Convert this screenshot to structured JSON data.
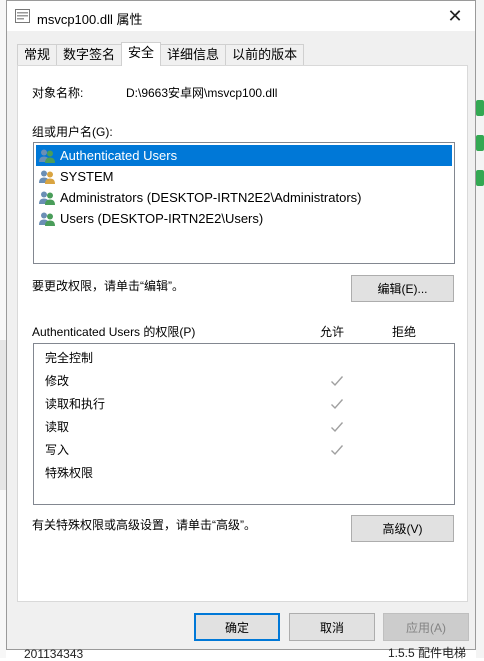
{
  "window": {
    "title": "msvcp100.dll 属性",
    "close_glyph": "✕"
  },
  "tabs": [
    {
      "label": "常规"
    },
    {
      "label": "数字签名"
    },
    {
      "label": "安全"
    },
    {
      "label": "详细信息"
    },
    {
      "label": "以前的版本"
    }
  ],
  "security": {
    "object_label": "对象名称:",
    "object_value": "D:\\9663安卓网\\msvcp100.dll",
    "group_label": "组或用户名(G):",
    "users": [
      {
        "name": "Authenticated Users",
        "icon": "users-group-icon"
      },
      {
        "name": "SYSTEM",
        "icon": "users-group-icon"
      },
      {
        "name": "Administrators (DESKTOP-IRTN2E2\\Administrators)",
        "icon": "users-group-icon"
      },
      {
        "name": "Users (DESKTOP-IRTN2E2\\Users)",
        "icon": "users-group-icon"
      }
    ],
    "selected_user_index": 0,
    "change_hint": "要更改权限，请单击“编辑”。",
    "edit_button": "编辑(E)...",
    "permissions_title": "Authenticated Users 的权限(P)",
    "allow_header": "允许",
    "deny_header": "拒绝",
    "permissions": [
      {
        "name": "完全控制",
        "allow": false,
        "deny": false
      },
      {
        "name": "修改",
        "allow": true,
        "deny": false
      },
      {
        "name": "读取和执行",
        "allow": true,
        "deny": false
      },
      {
        "name": "读取",
        "allow": true,
        "deny": false
      },
      {
        "name": "写入",
        "allow": true,
        "deny": false
      },
      {
        "name": "特殊权限",
        "allow": false,
        "deny": false
      }
    ],
    "advanced_hint": "有关特殊权限或高级设置，请单击“高级”。",
    "advanced_button": "高级(V)"
  },
  "footer": {
    "ok": "确定",
    "cancel": "取消",
    "apply": "应用(A)"
  },
  "behind_window": {
    "left_text": "201134343",
    "right_text": "1.5.5 配件电梯"
  },
  "colors": {
    "selection": "#0078d7",
    "check": "#a0a0a0",
    "dialog_bg": "#f0f0f0"
  }
}
